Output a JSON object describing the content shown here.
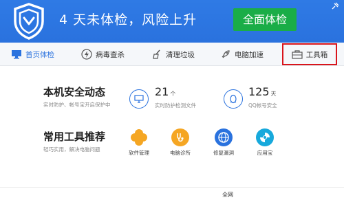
{
  "header": {
    "headline": "4 天未体检，风险上升",
    "cta_label": "全面体检"
  },
  "nav": {
    "items": [
      {
        "label": "首页体检"
      },
      {
        "label": "病毒查杀"
      },
      {
        "label": "清理垃圾"
      },
      {
        "label": "电脑加速"
      },
      {
        "label": "工具箱"
      }
    ]
  },
  "security": {
    "title": "本机安全动态",
    "subtitle": "实时防护、帐号宝开启保护中",
    "stats": [
      {
        "value": "21",
        "unit": "个",
        "desc": "实时防护检测文件"
      },
      {
        "value": "125",
        "unit": "天",
        "desc": "QQ帐号安全"
      }
    ]
  },
  "tools": {
    "title": "常用工具推荐",
    "subtitle": "轻巧实用，解决电脑问题",
    "items": [
      {
        "label": "软件管理",
        "color": "#f5a623"
      },
      {
        "label": "电脑诊所",
        "color": "#f5a623"
      },
      {
        "label": "修复漏洞",
        "color": "#2a72de"
      },
      {
        "label": "应用宝",
        "color": "#17a9dc"
      }
    ]
  },
  "footer": {
    "text": "全网"
  }
}
